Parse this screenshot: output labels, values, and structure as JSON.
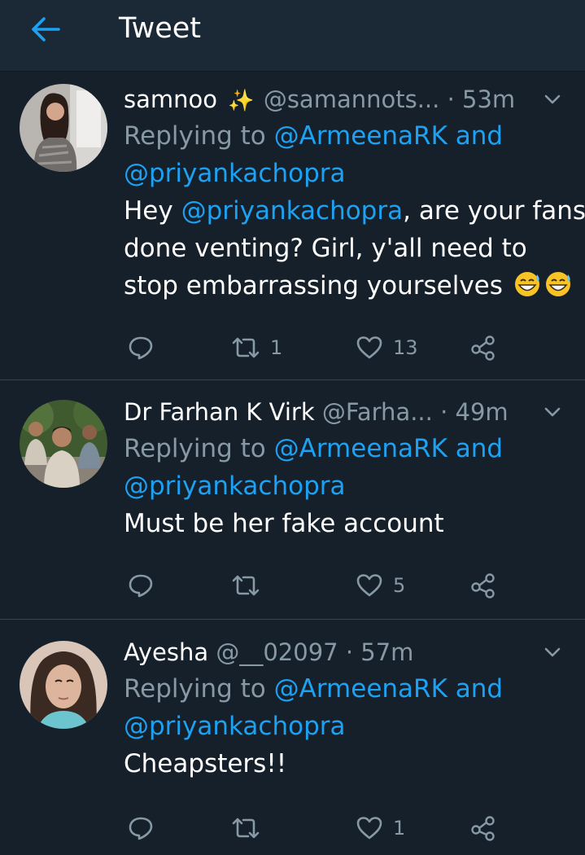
{
  "header": {
    "title": "Tweet"
  },
  "tweets": [
    {
      "author": "samnoo",
      "handle": "@samannots...",
      "separator": "·",
      "time": "53m",
      "reply_prefix": "Replying to",
      "reply_mention_1": "@ArmeenaRK",
      "reply_and": "and",
      "reply_mention_2": "@priyankachopra",
      "body": {
        "line1_pre": "Hey ",
        "line1_mention": "@priyankachopra",
        "line1_post": ", are your fans",
        "line2": "done venting? Girl, y'all need to",
        "line3": "stop embarrassing yourselves"
      },
      "retweets": "1",
      "likes": "13"
    },
    {
      "author": "Dr Farhan K Virk",
      "handle": "@Farha...",
      "separator": "·",
      "time": "49m",
      "reply_prefix": "Replying to",
      "reply_mention_1": "@ArmeenaRK",
      "reply_and": "and",
      "reply_mention_2": "@priyankachopra",
      "body": {
        "line1": "Must be her fake account"
      },
      "retweets": "",
      "likes": "5"
    },
    {
      "author": "Ayesha",
      "handle": "@__02097",
      "separator": "·",
      "time": "57m",
      "reply_prefix": "Replying to",
      "reply_mention_1": "@ArmeenaRK",
      "reply_and": "and",
      "reply_mention_2": "@priyankachopra",
      "body": {
        "line1": "Cheapsters!!"
      },
      "retweets": "",
      "likes": "1"
    }
  ],
  "icons": {
    "back": "back-arrow-icon",
    "reply": "reply-icon",
    "retweet": "retweet-icon",
    "like": "heart-icon",
    "share": "share-icon",
    "more": "chevron-down-icon",
    "sparkles": "sparkles-icon",
    "emoji": "grinning-sweat-emoji-icon"
  },
  "colors": {
    "background": "#15202b",
    "header": "#1b2836",
    "accent": "#1da1f2",
    "secondary_text": "#8899a6",
    "divider": "#38444d"
  }
}
